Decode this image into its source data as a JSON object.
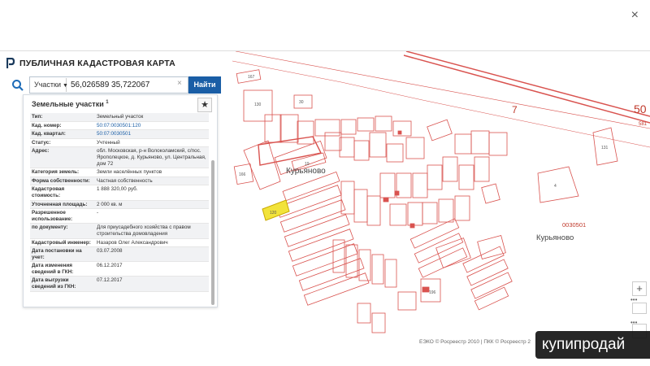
{
  "window": {
    "close_glyph": "×"
  },
  "app": {
    "title": "ПУБЛИЧНАЯ КАДАСТРОВАЯ КАРТА"
  },
  "search": {
    "category": "Участки",
    "value": "56,026589 35,722067",
    "clear_glyph": "×",
    "button": "Найти"
  },
  "panel": {
    "title": "Земельные участки",
    "title_sup": "1",
    "star_glyph": "★",
    "rows": [
      {
        "label": "Тип:",
        "value": "Земельный участок"
      },
      {
        "label": "Кад. номер:",
        "value": "50:07:0030501:120"
      },
      {
        "label": "Кад. квартал:",
        "value": "50:07:0030501"
      },
      {
        "label": "Статус:",
        "value": "Учтенный"
      },
      {
        "label": "Адрес:",
        "value": "обл. Московская, р-н Волоколамский, с/пос. Ярополецкое, д. Курьяново, ул. Центральная, дом 72"
      },
      {
        "label": "Категория земель:",
        "value": "Земли населённых пунктов"
      },
      {
        "label": "Форма собственности:",
        "value": "Частная собственность"
      },
      {
        "label": "Кадастровая стоимость:",
        "value": "1 888 320,00 руб."
      },
      {
        "label": "Уточненная площадь:",
        "value": "2 000 кв. м"
      },
      {
        "label": "Разрешенное использование:",
        "value": "-"
      },
      {
        "label": "по документу:",
        "value": "Для приусадебного хозяйства с правом строительства домовладения"
      },
      {
        "label": "Кадастровый инженер:",
        "value": "Назаров Олег Александрович"
      },
      {
        "label": "Дата постановки на учет:",
        "value": "03.07.2008"
      },
      {
        "label": "Дата изменения сведений в ГКН:",
        "value": "06.12.2017"
      },
      {
        "label": "Дата выгрузки сведений из ГКН:",
        "value": "07.12.2017"
      }
    ]
  },
  "map": {
    "labels": {
      "village_center": "Курьяново",
      "village_east": "Курьяново",
      "quarter": "0030501",
      "big_number": "7",
      "district_code": "50",
      "edge_code": "581",
      "parcel_130": "130",
      "parcel_167": "167",
      "parcel_30": "30",
      "parcel_166": "166",
      "parcel_4": "4",
      "parcel_19": "19",
      "parcel_120": "120",
      "parcel_196": "196",
      "parcel_131": "131"
    },
    "attribution": "ЕЭКО © Росреестр 2010 | ПКК © Росреестр 2",
    "controls": {
      "plus": "+",
      "dots": "•••"
    }
  },
  "watermark": {
    "text": "купипродай"
  },
  "colors": {
    "parcel": "#d9534f",
    "selected": "#f2e33a",
    "accent": "#1a5ea6"
  }
}
